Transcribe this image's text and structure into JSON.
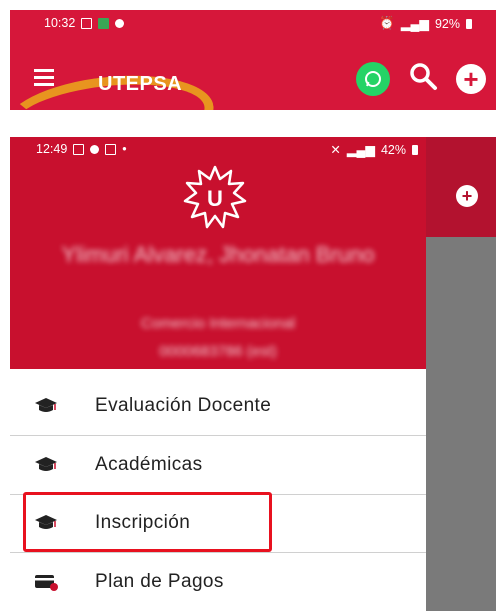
{
  "top_screenshot": {
    "status_bar": {
      "time": "10:32",
      "battery": "92%"
    },
    "app_title": "UTEPSA",
    "icons": [
      "menu-icon",
      "whatsapp-icon",
      "search-icon",
      "add-icon"
    ],
    "colors": {
      "app_bar": "#d6173a",
      "annotation_circle": "#e8941f"
    }
  },
  "drawer_screenshot": {
    "status_bar": {
      "time": "12:49",
      "battery": "42%"
    },
    "logo_letter": "U",
    "user": {
      "name": "Ylimuri Alvarez, Jhonatan Bruno",
      "career": "Comercio Internacional",
      "code": "0000683786 (est)"
    },
    "menu_items": [
      {
        "label": "Evaluación Docente",
        "icon": "graduation-cap-icon"
      },
      {
        "label": "Académicas",
        "icon": "graduation-cap-icon"
      },
      {
        "label": "Inscripción",
        "icon": "graduation-cap-icon",
        "highlighted": true
      },
      {
        "label": "Plan de Pagos",
        "icon": "credit-card-icon"
      }
    ],
    "colors": {
      "drawer_header": "#c8102e",
      "highlight_box": "#e8111f"
    }
  }
}
